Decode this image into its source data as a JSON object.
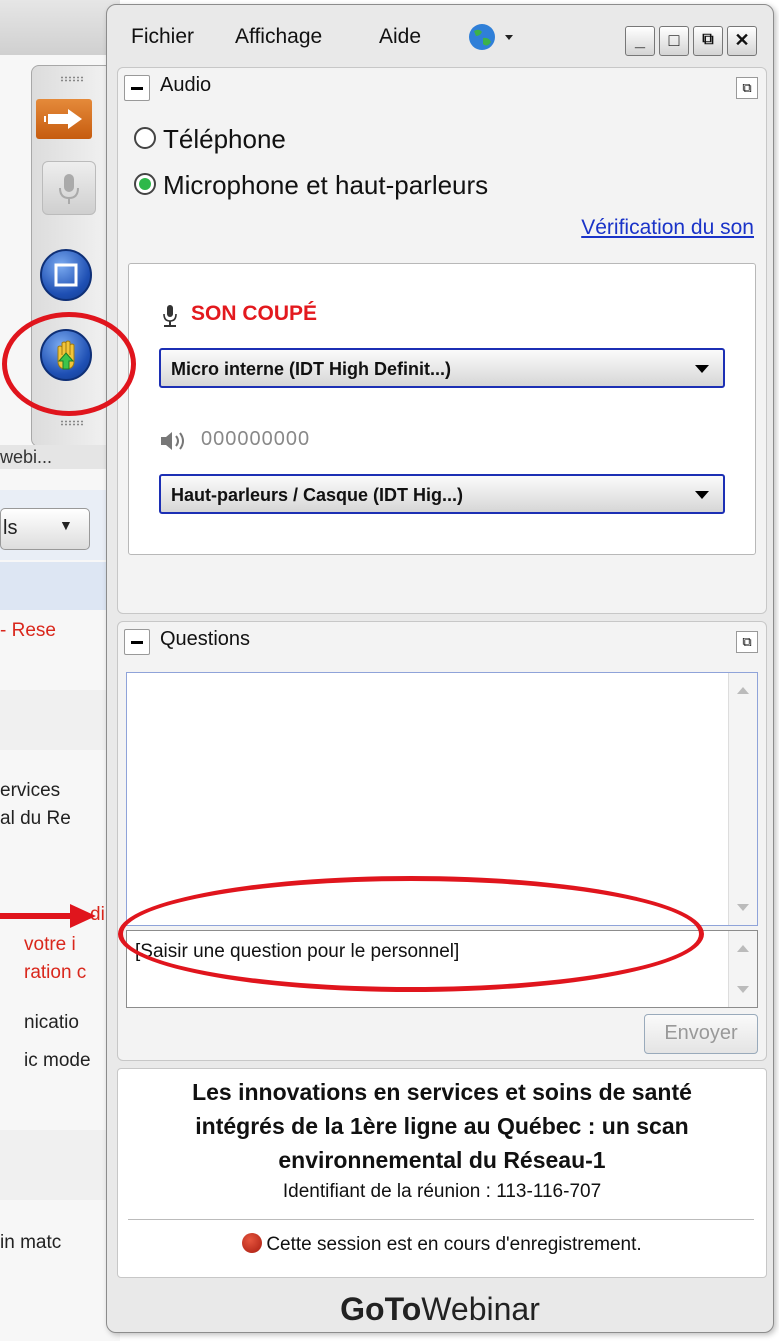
{
  "background_page": {
    "toolbar_label": "webi...",
    "dropdown_label": "ls",
    "snippets": [
      {
        "text": "- Rese",
        "top": 0,
        "red": true
      },
      {
        "text": "ervices",
        "red": false
      },
      {
        "text": "al du Re",
        "red": false
      },
      {
        "text": "ding",
        "red": true
      },
      {
        "text": "votre i",
        "red": true
      },
      {
        "text": "ration c",
        "red": true
      },
      {
        "text": "nicatio",
        "red": false
      },
      {
        "text": "ic mode",
        "red": false
      },
      {
        "text": "in matc",
        "red": false
      }
    ]
  },
  "menu": {
    "file": "Fichier",
    "view": "Affichage",
    "help": "Aide"
  },
  "window_buttons": {
    "minimize": "_",
    "maximize": "□",
    "restore": "⧉",
    "close": "✕"
  },
  "audio": {
    "title": "Audio",
    "option_phone": "Téléphone",
    "option_mic": "Microphone et haut-parleurs",
    "selected": "Microphone et haut-parleurs",
    "sound_check_link": "Vérification du son",
    "mute_status": "SON COUPÉ",
    "mic_device": "Micro interne (IDT High Definit...)",
    "speaker_level": "000000000",
    "speaker_device": "Haut-parleurs / Casque (IDT Hig...)"
  },
  "questions": {
    "title": "Questions",
    "input_placeholder": "[Saisir une question pour le personnel]",
    "send_label": "Envoyer"
  },
  "info": {
    "title_line1": "Les innovations en services et soins de santé",
    "title_line2": "intégrés de la 1ère ligne au Québec : un scan",
    "title_line3": "environnemental du Réseau-1",
    "meeting_id": "Identifiant de la réunion : 113-116-707",
    "recording": "Cette session est en cours d'enregistrement."
  },
  "brand": {
    "bold": "GoTo",
    "regular": "Webinar"
  },
  "colors": {
    "annotation_red": "#e0151d",
    "muted_red": "#e3191e",
    "link_blue": "#1a33c8",
    "select_border": "#1c2fb4"
  }
}
